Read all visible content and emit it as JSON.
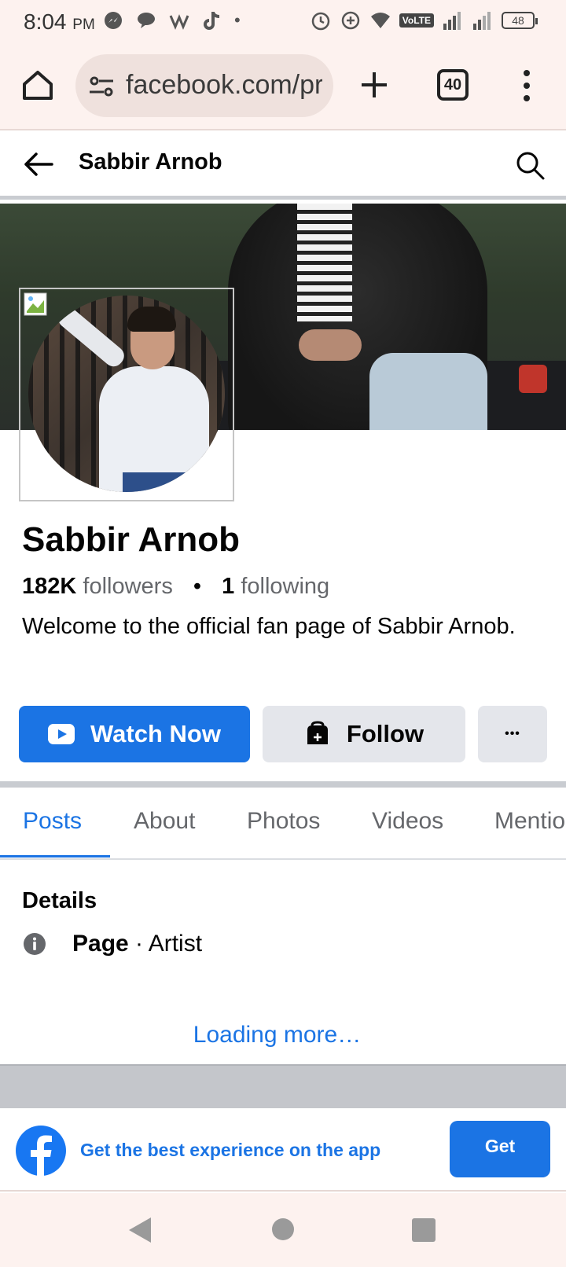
{
  "status_bar": {
    "time": "8:04",
    "ampm": "PM",
    "network": "VoLTE",
    "battery": "48"
  },
  "browser": {
    "url": "facebook.com/pro",
    "tab_count": "40"
  },
  "header": {
    "title": "Sabbir Arnob"
  },
  "profile": {
    "name": "Sabbir Arnob",
    "followers_count": "182K",
    "followers_label": "followers",
    "separator": "•",
    "following_count": "1",
    "following_label": "following",
    "bio": "Welcome to the official fan page of Sabbir Arnob."
  },
  "actions": {
    "watch_label": "Watch Now",
    "follow_label": "Follow",
    "more_label": "•••"
  },
  "tabs": [
    {
      "label": "Posts",
      "active": true
    },
    {
      "label": "About",
      "active": false
    },
    {
      "label": "Photos",
      "active": false
    },
    {
      "label": "Videos",
      "active": false
    },
    {
      "label": "Mentions",
      "active": false
    }
  ],
  "details": {
    "title": "Details",
    "type_bold": "Page",
    "type_rest": " · Artist"
  },
  "loading_text": "Loading more…",
  "app_banner": {
    "text": "Get the best experience on the app",
    "button_label": "Get"
  },
  "colors": {
    "accent": "#1b74e4",
    "secondary_button": "#e4e6eb",
    "browser_chrome": "#fdf2ef"
  },
  "icons": {
    "home": "home-icon",
    "site_settings": "tune-icon",
    "new_tab": "plus-icon",
    "tabs": "tab-switcher-icon",
    "menu": "more-vert-icon",
    "back": "arrow-left-icon",
    "search": "search-icon",
    "watch": "youtube-play-icon",
    "follow": "follow-bag-icon",
    "info": "info-icon",
    "facebook": "facebook-logo-icon"
  }
}
